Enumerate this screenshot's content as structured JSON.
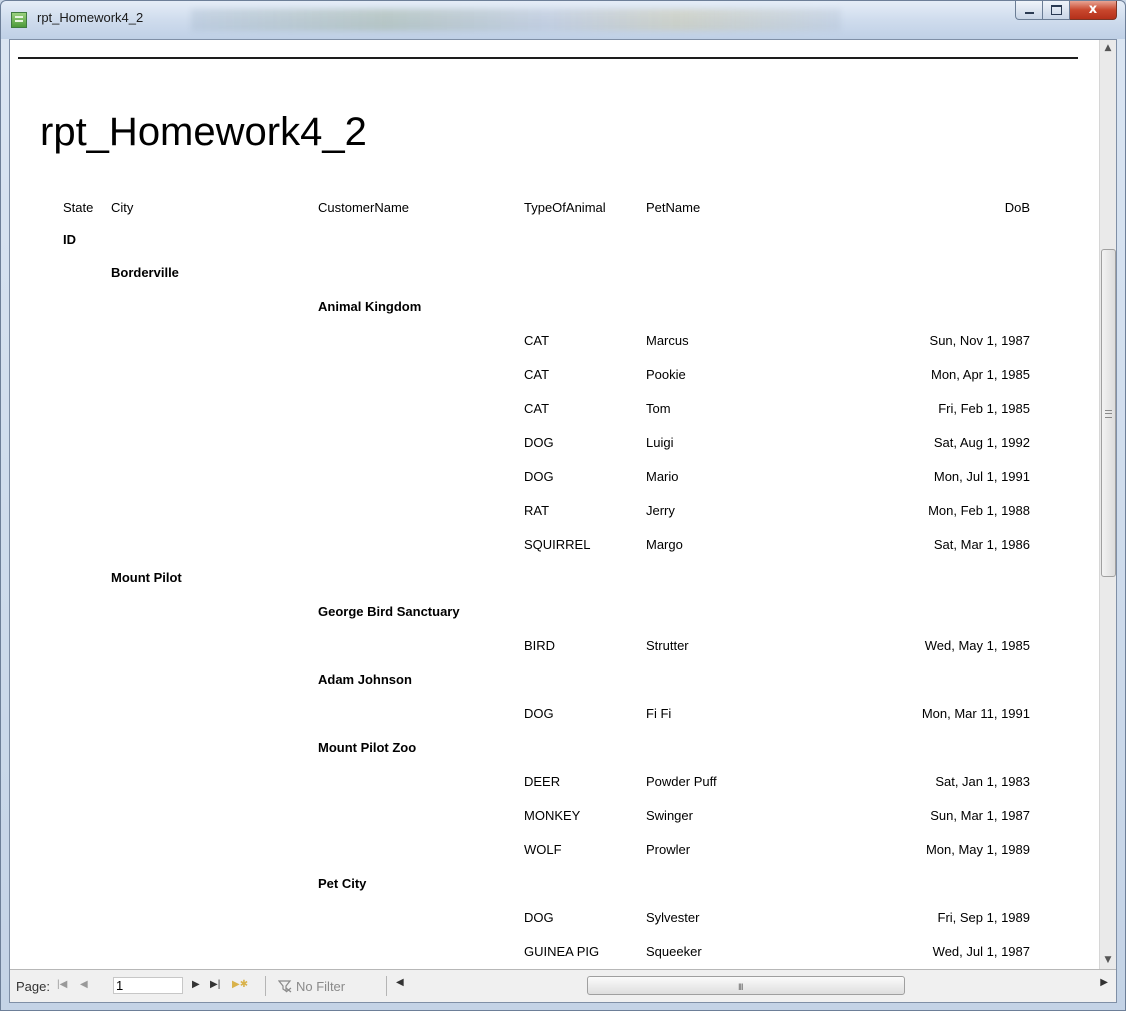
{
  "window": {
    "title": "rpt_Homework4_2",
    "close_glyph": "x"
  },
  "report": {
    "title": "rpt_Homework4_2",
    "headers": {
      "state": "State",
      "city": "City",
      "customer": "CustomerName",
      "type": "TypeOfAnimal",
      "pet": "PetName",
      "dob": "DoB"
    },
    "groups": {
      "state_id": "ID",
      "city_borderville": "Borderville",
      "cust_animal_kingdom": "Animal Kingdom",
      "city_mount_pilot": "Mount Pilot",
      "cust_george": "George Bird Sanctuary",
      "cust_adam": "Adam Johnson",
      "cust_mpz": "Mount Pilot Zoo",
      "cust_petcity": "Pet City"
    },
    "rows": [
      {
        "type": "CAT",
        "pet": "Marcus",
        "dob": "Sun, Nov 1,  1987"
      },
      {
        "type": "CAT",
        "pet": "Pookie",
        "dob": "Mon, Apr 1,  1985"
      },
      {
        "type": "CAT",
        "pet": "Tom",
        "dob": "Fri, Feb 1,  1985"
      },
      {
        "type": "DOG",
        "pet": "Luigi",
        "dob": "Sat, Aug 1,  1992"
      },
      {
        "type": "DOG",
        "pet": "Mario",
        "dob": "Mon, Jul 1,  1991"
      },
      {
        "type": "RAT",
        "pet": "Jerry",
        "dob": "Mon, Feb 1,  1988"
      },
      {
        "type": "SQUIRREL",
        "pet": "Margo",
        "dob": "Sat, Mar 1,  1986"
      },
      {
        "type": "BIRD",
        "pet": "Strutter",
        "dob": "Wed, May 1,  1985"
      },
      {
        "type": "DOG",
        "pet": "Fi Fi",
        "dob": "Mon, Mar 11,  1991"
      },
      {
        "type": "DEER",
        "pet": "Powder Puff",
        "dob": "Sat, Jan 1,  1983"
      },
      {
        "type": "MONKEY",
        "pet": "Swinger",
        "dob": "Sun, Mar 1,  1987"
      },
      {
        "type": "WOLF",
        "pet": "Prowler",
        "dob": "Mon, May 1,  1989"
      },
      {
        "type": "DOG",
        "pet": "Sylvester",
        "dob": "Fri, Sep 1,  1989"
      },
      {
        "type": "GUINEA PIG",
        "pet": "Squeeker",
        "dob": "Wed, Jul 1,  1987"
      }
    ]
  },
  "navbar": {
    "page_label": "Page:",
    "page_value": "1",
    "filter_label": "No Filter",
    "grip": "III"
  }
}
